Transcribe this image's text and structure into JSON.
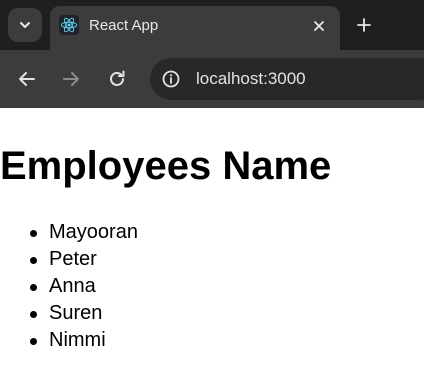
{
  "browser": {
    "tab": {
      "title": "React App",
      "favicon": "react-logo-icon"
    },
    "address": {
      "url": "localhost:3000"
    },
    "icons": {
      "tab_search": "chevron-down-icon",
      "close": "close-icon",
      "new_tab": "plus-icon",
      "back": "arrow-left-icon",
      "forward": "arrow-right-icon",
      "reload": "reload-icon",
      "site_info": "info-icon"
    },
    "colors": {
      "tabstrip": "#1f1f1f",
      "toolbar": "#3c3c3c",
      "omnibox": "#282828",
      "react": "#61dafb"
    }
  },
  "page": {
    "heading": "Employees Name",
    "employees": [
      "Mayooran",
      "Peter",
      "Anna",
      "Suren",
      "Nimmi"
    ]
  }
}
